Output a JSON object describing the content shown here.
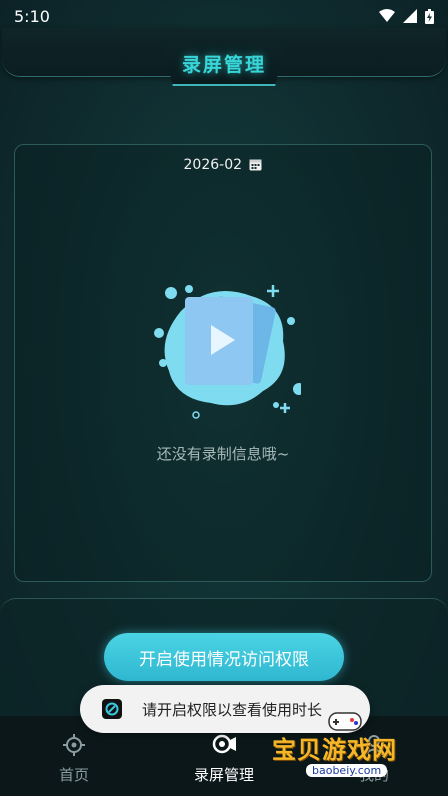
{
  "status_bar": {
    "time": "5:10"
  },
  "header": {
    "title": "录屏管理"
  },
  "card": {
    "date": "2026-02",
    "empty_message": "还没有录制信息哦~"
  },
  "permission_button": {
    "label": "开启使用情况访问权限"
  },
  "toast": {
    "message": "请开启权限以查看使用时长"
  },
  "nav": {
    "items": [
      {
        "label": "首页",
        "icon": "target-icon"
      },
      {
        "label": "录屏管理",
        "icon": "record-icon"
      },
      {
        "label": "我的",
        "icon": "profile-icon"
      }
    ]
  },
  "watermark": {
    "text": "宝贝游戏网",
    "url": "baobeiy.com"
  },
  "colors": {
    "accent": "#38d6d8",
    "button": "#3ac6dc",
    "background": "#0f2c2f"
  }
}
